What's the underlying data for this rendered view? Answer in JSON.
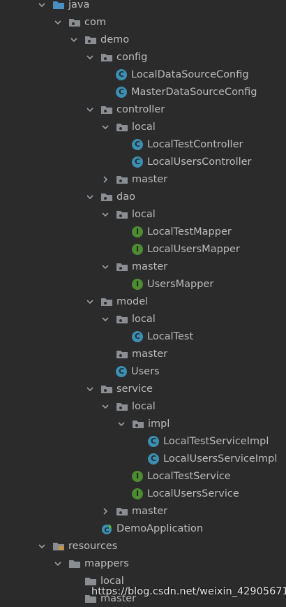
{
  "tree": [
    {
      "label": "java",
      "indent": 75,
      "arrow": "down",
      "icon": "folder-src"
    },
    {
      "label": "com",
      "indent": 98,
      "arrow": "down",
      "icon": "package"
    },
    {
      "label": "demo",
      "indent": 121,
      "arrow": "down",
      "icon": "package"
    },
    {
      "label": "config",
      "indent": 144,
      "arrow": "down",
      "icon": "package"
    },
    {
      "label": "LocalDataSourceConfig",
      "indent": 166,
      "arrow": "none",
      "icon": "class"
    },
    {
      "label": "MasterDataSourceConfig",
      "indent": 166,
      "arrow": "none",
      "icon": "class"
    },
    {
      "label": "controller",
      "indent": 144,
      "arrow": "down",
      "icon": "package"
    },
    {
      "label": "local",
      "indent": 166,
      "arrow": "down",
      "icon": "package"
    },
    {
      "label": "LocalTestController",
      "indent": 189,
      "arrow": "none",
      "icon": "class"
    },
    {
      "label": "LocalUsersController",
      "indent": 189,
      "arrow": "none",
      "icon": "class"
    },
    {
      "label": "master",
      "indent": 166,
      "arrow": "right",
      "icon": "package"
    },
    {
      "label": "dao",
      "indent": 144,
      "arrow": "down",
      "icon": "package"
    },
    {
      "label": "local",
      "indent": 166,
      "arrow": "down",
      "icon": "package"
    },
    {
      "label": "LocalTestMapper",
      "indent": 189,
      "arrow": "none",
      "icon": "interface"
    },
    {
      "label": "LocalUsersMapper",
      "indent": 189,
      "arrow": "none",
      "icon": "interface"
    },
    {
      "label": "master",
      "indent": 166,
      "arrow": "down",
      "icon": "package"
    },
    {
      "label": "UsersMapper",
      "indent": 189,
      "arrow": "none",
      "icon": "interface"
    },
    {
      "label": "model",
      "indent": 144,
      "arrow": "down",
      "icon": "package"
    },
    {
      "label": "local",
      "indent": 166,
      "arrow": "down",
      "icon": "package"
    },
    {
      "label": "LocalTest",
      "indent": 189,
      "arrow": "none",
      "icon": "class"
    },
    {
      "label": "master",
      "indent": 166,
      "arrow": "none",
      "icon": "package"
    },
    {
      "label": "Users",
      "indent": 166,
      "arrow": "none",
      "icon": "class"
    },
    {
      "label": "service",
      "indent": 144,
      "arrow": "down",
      "icon": "package"
    },
    {
      "label": "local",
      "indent": 166,
      "arrow": "down",
      "icon": "package"
    },
    {
      "label": "impl",
      "indent": 189,
      "arrow": "down",
      "icon": "package"
    },
    {
      "label": "LocalTestServiceImpl",
      "indent": 212,
      "arrow": "none",
      "icon": "class"
    },
    {
      "label": "LocalUsersServiceImpl",
      "indent": 212,
      "arrow": "none",
      "icon": "class"
    },
    {
      "label": "LocalTestService",
      "indent": 189,
      "arrow": "none",
      "icon": "interface"
    },
    {
      "label": "LocalUsersService",
      "indent": 189,
      "arrow": "none",
      "icon": "interface"
    },
    {
      "label": "master",
      "indent": 166,
      "arrow": "right",
      "icon": "package"
    },
    {
      "label": "DemoApplication",
      "indent": 144,
      "arrow": "none",
      "icon": "spring-app"
    },
    {
      "label": "resources",
      "indent": 75,
      "arrow": "down",
      "icon": "folder-res"
    },
    {
      "label": "mappers",
      "indent": 98,
      "arrow": "down",
      "icon": "folder"
    },
    {
      "label": "local",
      "indent": 121,
      "arrow": "none",
      "icon": "folder"
    },
    {
      "label": "master",
      "indent": 121,
      "arrow": "none",
      "icon": "folder"
    }
  ],
  "watermark": "https://blog.csdn.net/weixin_42905671",
  "colors": {
    "background": "#2b2b2b",
    "text": "#bbbbbb",
    "class": "#3c8fb0",
    "interface": "#4d8c33",
    "folder": "#8a8e92"
  }
}
